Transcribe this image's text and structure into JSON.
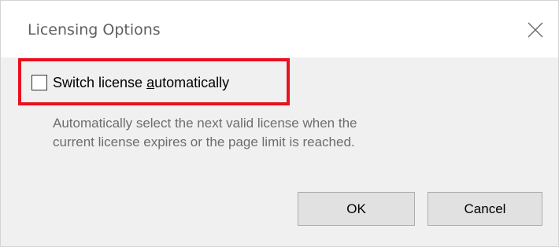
{
  "dialog": {
    "title": "Licensing Options",
    "close_icon": "close-icon"
  },
  "checkbox": {
    "label_prefix": "Switch license ",
    "label_mnemonic": "a",
    "label_suffix": "utomatically",
    "checked": false
  },
  "description": {
    "line1": "Automatically select the next valid license when the",
    "line2": "current license expires or the page limit is reached."
  },
  "buttons": {
    "ok_label": "OK",
    "cancel_label": "Cancel"
  },
  "colors": {
    "highlight": "#e8121f",
    "dialog_background": "#f0f0f0",
    "title_text": "#5f5f5f",
    "description_text": "#6d6d6d"
  }
}
